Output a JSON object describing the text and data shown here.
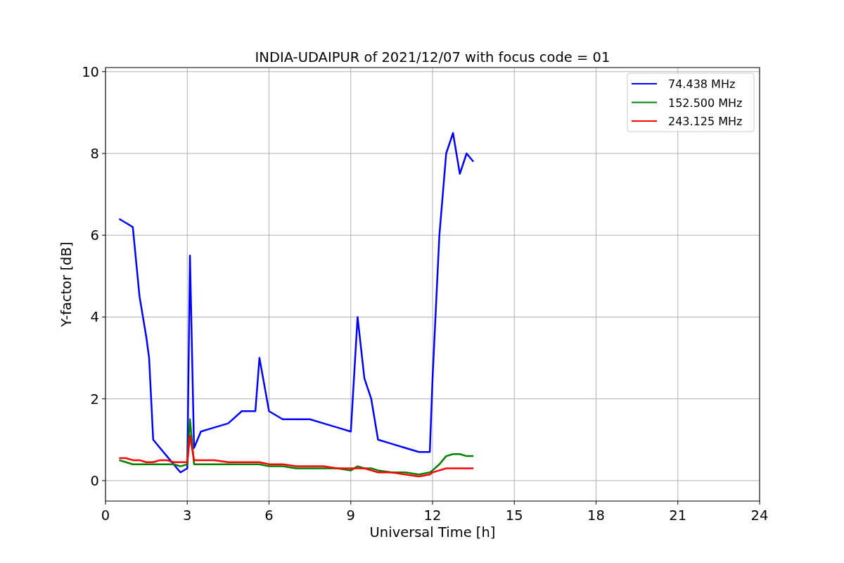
{
  "chart_data": {
    "type": "line",
    "title": "INDIA-UDAIPUR of 2021/12/07 with focus code = 01",
    "xlabel": "Universal Time [h]",
    "ylabel": "Y-factor [dB]",
    "xlim": [
      0,
      24
    ],
    "ylim": [
      -0.5,
      10.1
    ],
    "xticks": [
      0,
      3,
      6,
      9,
      12,
      15,
      18,
      21,
      24
    ],
    "yticks": [
      0,
      2,
      4,
      6,
      8,
      10
    ],
    "grid": true,
    "legend": true,
    "x": [
      0.5,
      0.75,
      1,
      1.25,
      1.5,
      1.6,
      1.75,
      2,
      2.25,
      2.5,
      2.75,
      3,
      3.1,
      3.25,
      3.5,
      4,
      4.5,
      5,
      5.5,
      5.65,
      6,
      6.5,
      7,
      7.5,
      8,
      8.5,
      9,
      9.25,
      9.5,
      9.75,
      10,
      10.5,
      11,
      11.5,
      11.9,
      12,
      12.25,
      12.5,
      12.75,
      13,
      13.25,
      13.5
    ],
    "series": [
      {
        "name": "74.438 MHz",
        "color": "#0000ff",
        "values": [
          6.4,
          6.3,
          6.2,
          4.5,
          3.5,
          3.0,
          1.0,
          0.8,
          0.6,
          0.4,
          0.2,
          0.3,
          5.5,
          0.8,
          1.2,
          1.3,
          1.4,
          1.7,
          1.7,
          3.0,
          1.7,
          1.5,
          1.5,
          1.5,
          1.4,
          1.3,
          1.2,
          4.0,
          2.5,
          2.0,
          1.0,
          0.9,
          0.8,
          0.7,
          0.7,
          2.5,
          6.0,
          8.0,
          8.5,
          7.5,
          8.0,
          7.8
        ]
      },
      {
        "name": "152.500 MHz",
        "color": "#008000",
        "values": [
          0.5,
          0.45,
          0.4,
          0.4,
          0.4,
          0.4,
          0.4,
          0.4,
          0.4,
          0.4,
          0.35,
          0.4,
          1.5,
          0.4,
          0.4,
          0.4,
          0.4,
          0.4,
          0.4,
          0.4,
          0.35,
          0.35,
          0.3,
          0.3,
          0.3,
          0.3,
          0.25,
          0.35,
          0.3,
          0.3,
          0.25,
          0.2,
          0.2,
          0.15,
          0.2,
          0.25,
          0.4,
          0.6,
          0.65,
          0.65,
          0.6,
          0.6
        ]
      },
      {
        "name": "243.125 MHz",
        "color": "#ff0000",
        "values": [
          0.55,
          0.55,
          0.5,
          0.5,
          0.45,
          0.45,
          0.45,
          0.5,
          0.5,
          0.45,
          0.45,
          0.45,
          1.1,
          0.5,
          0.5,
          0.5,
          0.45,
          0.45,
          0.45,
          0.45,
          0.4,
          0.4,
          0.35,
          0.35,
          0.35,
          0.3,
          0.3,
          0.3,
          0.3,
          0.25,
          0.2,
          0.2,
          0.15,
          0.1,
          0.15,
          0.2,
          0.25,
          0.3,
          0.3,
          0.3,
          0.3,
          0.3
        ]
      }
    ]
  }
}
